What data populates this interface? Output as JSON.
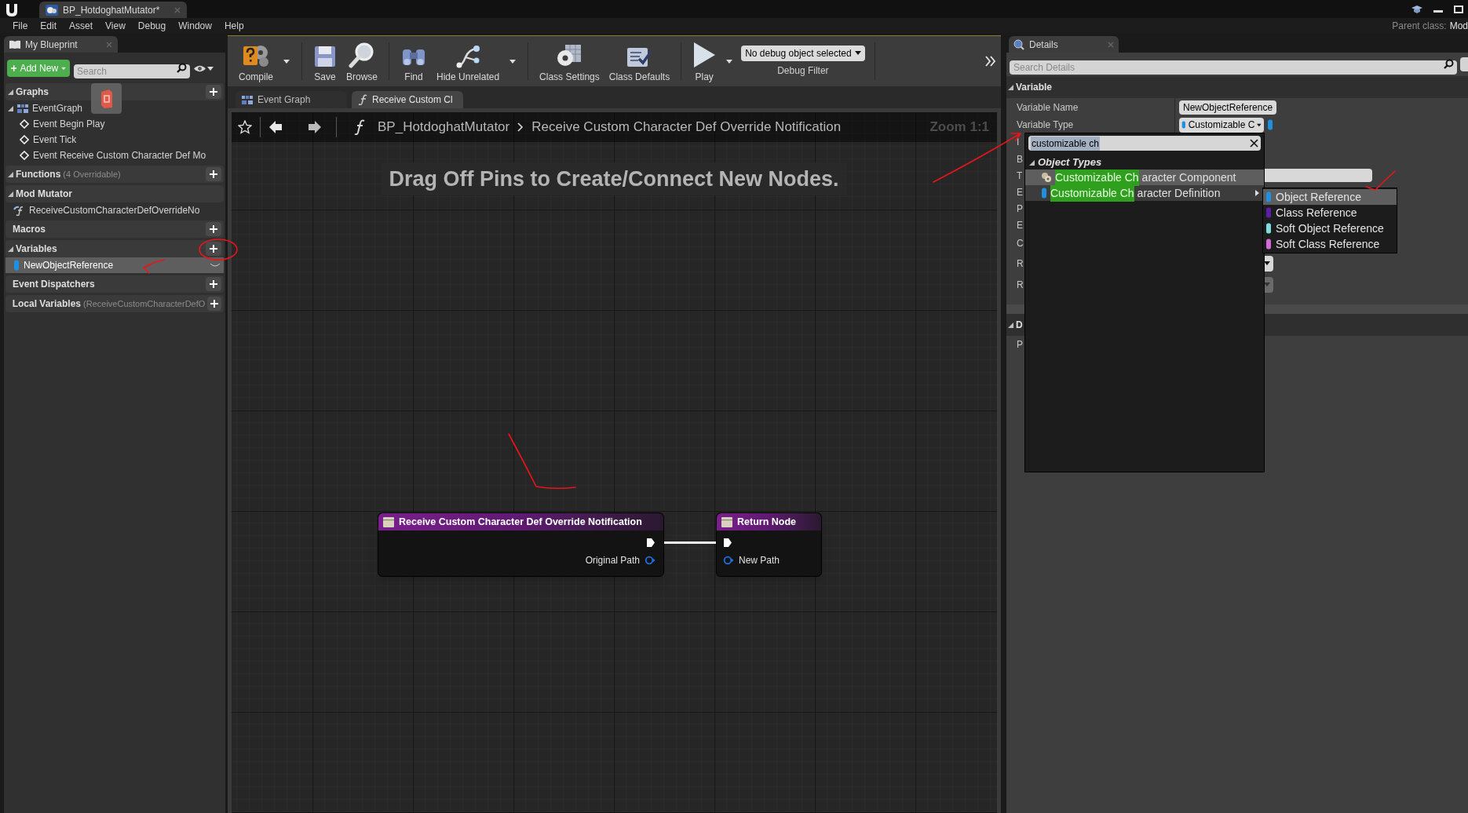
{
  "title_tab": {
    "label": "BP_HotdoghatMutator*"
  },
  "menu": [
    "File",
    "Edit",
    "Asset",
    "View",
    "Debug",
    "Window",
    "Help"
  ],
  "parent_class": {
    "label": "Parent class:",
    "value": "Mod"
  },
  "my_blueprint": {
    "tab": "My Blueprint",
    "add_new": "Add New",
    "search": {
      "placeholder": "Search"
    },
    "sections": [
      {
        "title": "Graphs",
        "expanded": true,
        "addable": true,
        "children": [
          {
            "label": "EventGraph",
            "kind": "graph",
            "selected": false,
            "expanded": true,
            "children": [
              {
                "label": "Event Begin Play",
                "kind": "event",
                "selected": false
              },
              {
                "label": "Event Tick",
                "kind": "event",
                "selected": false
              },
              {
                "label": "Event Receive Custom Character Def Mo",
                "kind": "event",
                "selected": false
              }
            ]
          }
        ]
      },
      {
        "title": "Functions",
        "note": "(4 Overridable)",
        "expanded": true,
        "addable": true
      },
      {
        "title": "Mod Mutator",
        "expanded": true,
        "addable": false,
        "children": [
          {
            "label": "ReceiveCustomCharacterDefOverrideNo",
            "kind": "override",
            "selected": false
          }
        ]
      },
      {
        "title": "Macros",
        "expanded": false,
        "addable": true
      },
      {
        "title": "Variables",
        "expanded": true,
        "addable": true,
        "children": [
          {
            "label": "NewObjectReference",
            "kind": "variable",
            "selected": true
          }
        ]
      },
      {
        "title": "Event Dispatchers",
        "expanded": false,
        "addable": true
      },
      {
        "title": "Local Variables",
        "note": "(ReceiveCustomCharacterDefO",
        "expanded": false,
        "addable": true
      }
    ]
  },
  "toolbar": {
    "groups": [
      [
        {
          "label": "Compile",
          "kind": "compile",
          "dropdown": true
        }
      ],
      [
        {
          "label": "Save",
          "kind": "save",
          "dropdown": false
        },
        {
          "label": "Browse",
          "kind": "browse",
          "dropdown": false
        }
      ],
      [
        {
          "label": "Find",
          "kind": "find",
          "dropdown": false
        },
        {
          "label": "Hide Unrelated",
          "kind": "hide",
          "dropdown": true
        }
      ],
      [
        {
          "label": "Class Settings",
          "kind": "settings",
          "dropdown": false
        },
        {
          "label": "Class Defaults",
          "kind": "defaults",
          "dropdown": false
        }
      ],
      [
        {
          "label": "Play",
          "kind": "play",
          "dropdown": true
        }
      ]
    ],
    "debug": {
      "value": "No debug object selected",
      "label": "Debug Filter"
    }
  },
  "graph_tabs": [
    {
      "label": "Event Graph",
      "kind": "graph",
      "selected": false
    },
    {
      "label": "Receive Custom Cl",
      "kind": "function",
      "selected": true
    }
  ],
  "breadcrumb": {
    "blueprint": "BP_HotdoghatMutator",
    "function": "Receive Custom Character Def Override Notification",
    "zoom": "Zoom 1:1"
  },
  "hint": "Drag Off Pins to Create/Connect New Nodes.",
  "nodes": [
    {
      "title": "Receive Custom Character Def Override Notification",
      "pin": "Original Path",
      "kind": "entry"
    },
    {
      "title": "Return Node",
      "pin": "New Path",
      "kind": "return"
    }
  ],
  "details": {
    "tab": "Details",
    "search": {
      "placeholder": "Search Details"
    },
    "sections": [
      {
        "title": "Variable",
        "rows": [
          {
            "label": "Variable Name",
            "kind": "text",
            "value": "NewObjectReference"
          },
          {
            "label": "Variable Type",
            "kind": "type",
            "value": "Customizable C",
            "color": "#1f8fe0"
          },
          {
            "label": "I",
            "kind": "none"
          },
          {
            "label": "B",
            "kind": "none"
          },
          {
            "label": "T",
            "kind": "field"
          },
          {
            "label": "E",
            "kind": "none"
          },
          {
            "label": "P",
            "kind": "none"
          },
          {
            "label": "E",
            "kind": "none"
          },
          {
            "label": "C",
            "kind": "none"
          },
          {
            "label": "R",
            "kind": "dropdown",
            "disabled": false
          },
          {
            "label": "R",
            "kind": "dropdown",
            "disabled": true
          }
        ]
      },
      {
        "title": "D",
        "rows": [
          {
            "label": "P",
            "kind": "none"
          }
        ]
      }
    ]
  },
  "type_picker": {
    "search": {
      "value": "customizable ch"
    },
    "group": "Object Types",
    "items": [
      {
        "match": "Customizable Ch",
        "rest": "aracter Component",
        "kind": "component",
        "selected": true,
        "submenu": false
      },
      {
        "match": "Customizable Ch",
        "rest": "aracter Definition",
        "kind": "variable",
        "selected": false,
        "submenu": true
      }
    ],
    "submenu": [
      {
        "label": "Object Reference",
        "color": "#1f8fe0",
        "selected": true
      },
      {
        "label": "Class Reference",
        "color": "#5a1fa8",
        "selected": false
      },
      {
        "label": "Soft Object Reference",
        "color": "#7fdde0",
        "selected": false
      },
      {
        "label": "Soft Class Reference",
        "color": "#d26ad8",
        "selected": false
      }
    ]
  }
}
